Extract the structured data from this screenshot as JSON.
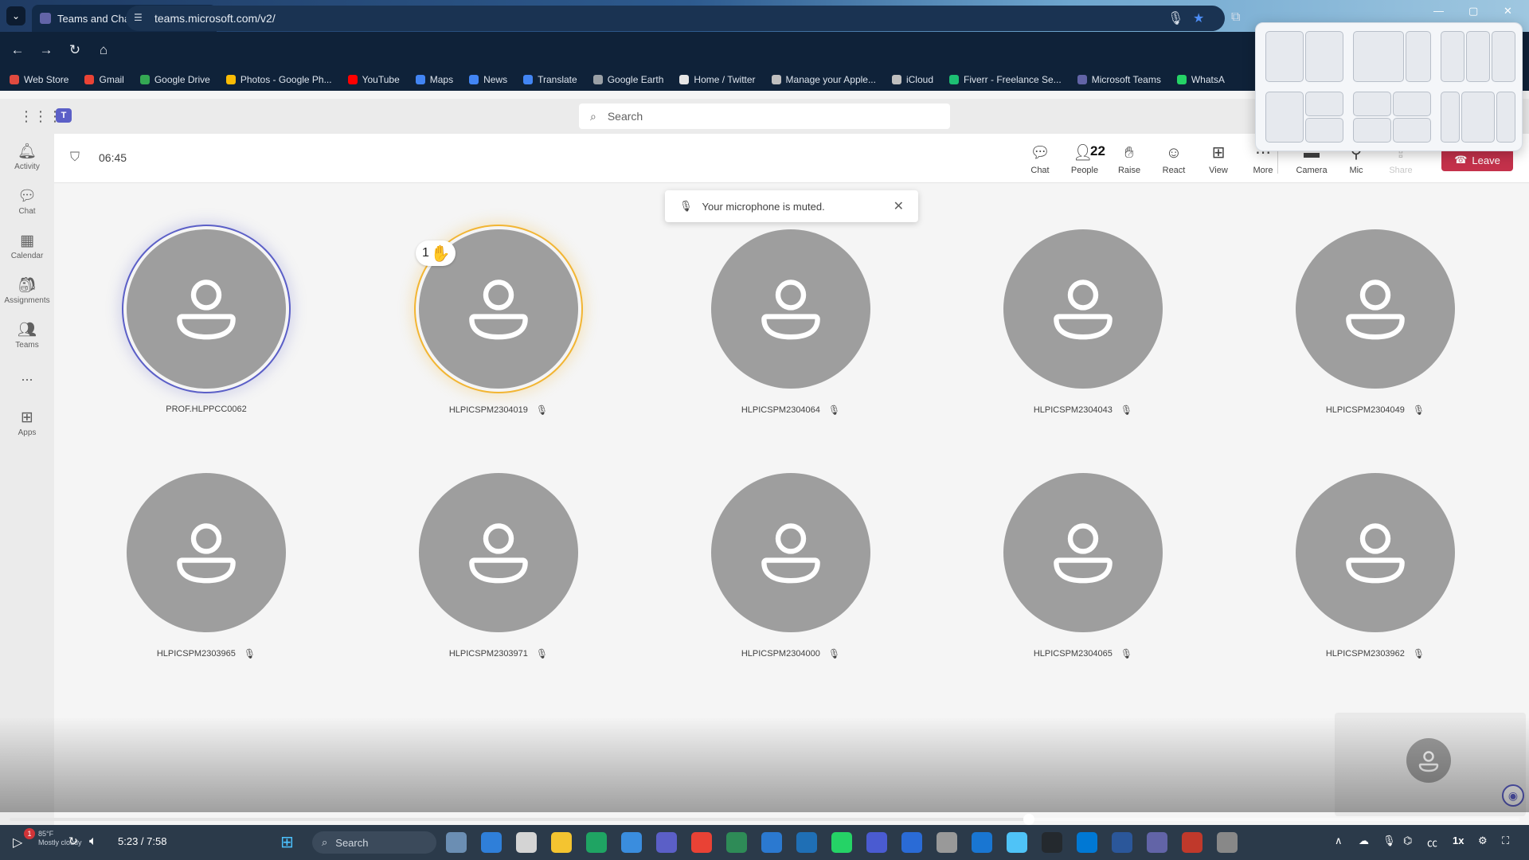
{
  "browser": {
    "tab_title": "Teams and Channels | New",
    "url": "teams.microsoft.com/v2/",
    "bookmarks": [
      {
        "label": "Web Store",
        "color": "#e04a3f"
      },
      {
        "label": "Gmail",
        "color": "#ea4335"
      },
      {
        "label": "Google Drive",
        "color": "#34a853"
      },
      {
        "label": "Photos - Google Ph...",
        "color": "#fbbc05"
      },
      {
        "label": "YouTube",
        "color": "#ff0000"
      },
      {
        "label": "Maps",
        "color": "#4285f4"
      },
      {
        "label": "News",
        "color": "#4285f4"
      },
      {
        "label": "Translate",
        "color": "#4285f4"
      },
      {
        "label": "Google Earth",
        "color": "#9aa0a6"
      },
      {
        "label": "Home / Twitter",
        "color": "#e6e6e6"
      },
      {
        "label": "Manage your Apple...",
        "color": "#bfbfbf"
      },
      {
        "label": "iCloud",
        "color": "#bfbfbf"
      },
      {
        "label": "Fiverr - Freelance Se...",
        "color": "#1dbf73"
      },
      {
        "label": "Microsoft Teams",
        "color": "#6264a7"
      },
      {
        "label": "WhatsA",
        "color": "#25d366"
      }
    ]
  },
  "teams": {
    "search_placeholder": "Search",
    "rail": [
      "Activity",
      "Chat",
      "Calendar",
      "Assignments",
      "Teams",
      "Apps"
    ],
    "rail_more": "...",
    "meeting": {
      "timer": "06:45",
      "people_count": "22",
      "toolbar": [
        "Chat",
        "People",
        "Raise",
        "React",
        "View",
        "More",
        "Camera",
        "Mic",
        "Share"
      ],
      "leave_label": "Leave"
    },
    "toast": "Your microphone is muted.",
    "raised_hand_order": "1",
    "participants": [
      "PROF.HLPPCC0062",
      "HLPICSPM2304019",
      "HLPICSPM2304064",
      "HLPICSPM2304043",
      "HLPICSPM2304049",
      "HLPICSPM2303965",
      "HLPICSPM2303971",
      "HLPICSPM2304000",
      "HLPICSPM2304065",
      "HLPICSPM2303962"
    ]
  },
  "player": {
    "time": "5:23 / 7:58",
    "progress_fraction": 0.675,
    "speed": "1x",
    "notification_count": "1",
    "weather_temp": "85°F",
    "weather_desc": "Mostly cloudy"
  },
  "taskbar": {
    "search_placeholder": "Search"
  },
  "colors": {
    "accent": "#5b5fc7",
    "leave": "#c4314b",
    "hand": "#f2b533"
  }
}
